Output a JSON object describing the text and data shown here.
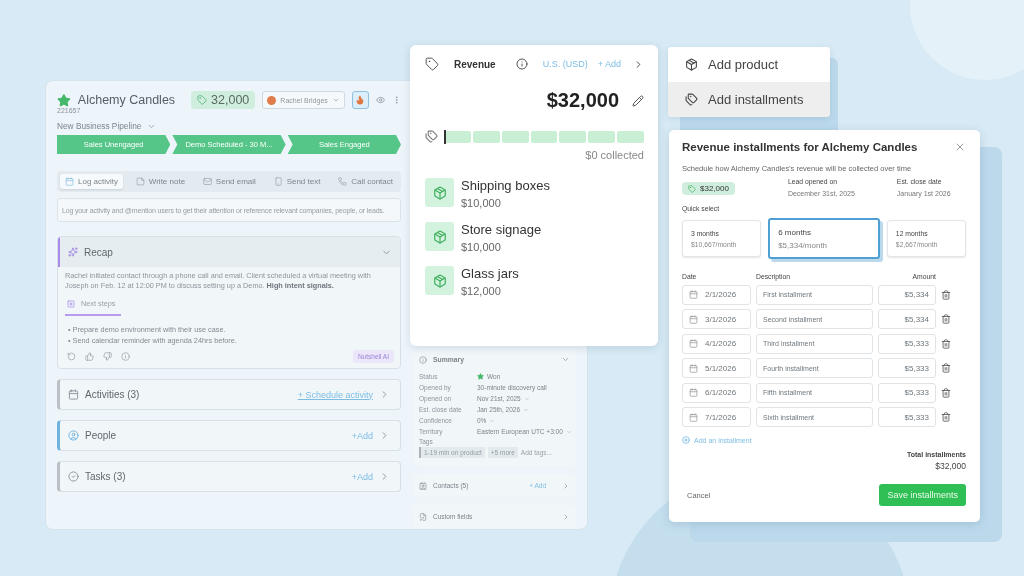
{
  "deal": {
    "starred": true,
    "name": "Alchemy Candles",
    "id": "221657",
    "value": "32,000",
    "owner": "Rachel Bridges",
    "hot": true
  },
  "pipeline": "New Business Pipeline",
  "stages": [
    "Sales Unengaged",
    "Demo Scheduled - 30 M...",
    "Sales Engaged"
  ],
  "actions": [
    {
      "label": "Log activity",
      "kind": "calendar",
      "selected": true
    },
    {
      "label": "Write note",
      "kind": "note",
      "selected": false
    },
    {
      "label": "Send email",
      "kind": "email",
      "selected": false
    },
    {
      "label": "Send text",
      "kind": "text",
      "selected": false
    },
    {
      "label": "Call contact",
      "kind": "call",
      "selected": false
    }
  ],
  "log_placeholder": "Log your activity and @mention users to get their attention or reference relevant companies, people, or leads.",
  "recap": {
    "title": "Recap",
    "expanded": true,
    "text": "Rachel initiated contact through a phone call and email. Client scheduled a virtual meeting with Joseph on Feb. 12 at 12:00 PM to discuss setting up a Demo.  **High intent signals.**",
    "tab": "Next steps",
    "steps": [
      "• Prepare demo environment with their use case.",
      "• Send calendar reminder with agenda 24hrs before."
    ],
    "badge": "Nutshell AI"
  },
  "sections": [
    {
      "title": "Activities (3)",
      "kind": "activities",
      "action": "+ Schedule activity"
    },
    {
      "title": "People",
      "kind": "people",
      "action": "+Add"
    },
    {
      "title": "Tasks (3)",
      "kind": "tasks",
      "action": "+Add"
    }
  ],
  "summary": {
    "title": "Summary",
    "expanded": true,
    "fields": [
      {
        "label": "Status",
        "value": "Won",
        "kind": "status"
      },
      {
        "label": "Opened by",
        "value": "30-minute discovery call",
        "kind": "text"
      },
      {
        "label": "Opened on",
        "value": "Nov 21st, 2025",
        "kind": "select"
      },
      {
        "label": "Est. close date",
        "value": "Jan 25th, 2026",
        "kind": "select"
      },
      {
        "label": "Confidence",
        "value": "0%",
        "kind": "select"
      },
      {
        "label": "Territory",
        "value": "Eastern European UTC +3:00",
        "kind": "select"
      }
    ],
    "tags_label": "Tags",
    "tags": [
      "1-19 min on product",
      "+5 more"
    ],
    "tags_placeholder": "Add tags..."
  },
  "side_sections": [
    {
      "title": "Contacts (5)",
      "kind": "contacts",
      "action": "+ Add"
    },
    {
      "title": "Custom fields",
      "kind": "custom"
    }
  ],
  "revenue": {
    "title": "Revenue",
    "currency": "U.S. (USD)",
    "add": "+ Add",
    "total": "$32,000",
    "collected": {
      "level": 0,
      "text": "$0 collected"
    },
    "products": [
      {
        "name": "Shipping boxes",
        "price": "$10,000"
      },
      {
        "name": "Store signage",
        "price": "$10,000"
      },
      {
        "name": "Glass jars",
        "price": "$12,000"
      }
    ]
  },
  "menu": [
    {
      "label": "Add product",
      "kind": "product",
      "selected": false
    },
    {
      "label": "Add installments",
      "kind": "installments",
      "selected": true
    }
  ],
  "modal": {
    "title": "Revenue installments for Alchemy Candles",
    "description": "Schedule how Alchemy Candles's revenue will be collected over time",
    "value": "$32,000",
    "info": [
      {
        "label": "Lead opened on",
        "value": "December 31st, 2025"
      },
      {
        "label": "Est. close date",
        "value": "January 1st 2026"
      }
    ],
    "quick_label": "Quick select",
    "options": [
      {
        "title": "3 months",
        "rate": "$10,667/month",
        "selected": false
      },
      {
        "title": "6 months",
        "rate": "$5,334/month",
        "selected": true
      },
      {
        "title": "12 months",
        "rate": "$2,667/month",
        "selected": false
      }
    ],
    "columns": [
      "Date",
      "Description",
      "Amount"
    ],
    "rows": [
      {
        "date": "2/1/2026",
        "description": "First installment",
        "amount": "$5,334"
      },
      {
        "date": "3/1/2026",
        "description": "Second installment",
        "amount": "$5,334"
      },
      {
        "date": "4/1/2026",
        "description": "Third installment",
        "amount": "$5,333"
      },
      {
        "date": "5/1/2026",
        "description": "Fourth installment",
        "amount": "$5,333"
      },
      {
        "date": "6/1/2026",
        "description": "Fifth installment",
        "amount": "$5,333"
      },
      {
        "date": "7/1/2026",
        "description": "Sixth installment",
        "amount": "$5,333"
      }
    ],
    "add_link": "Add an installment",
    "total_label": "Total installments",
    "total": "$32,000",
    "cancel": "Cancel",
    "save": "Save installments"
  }
}
